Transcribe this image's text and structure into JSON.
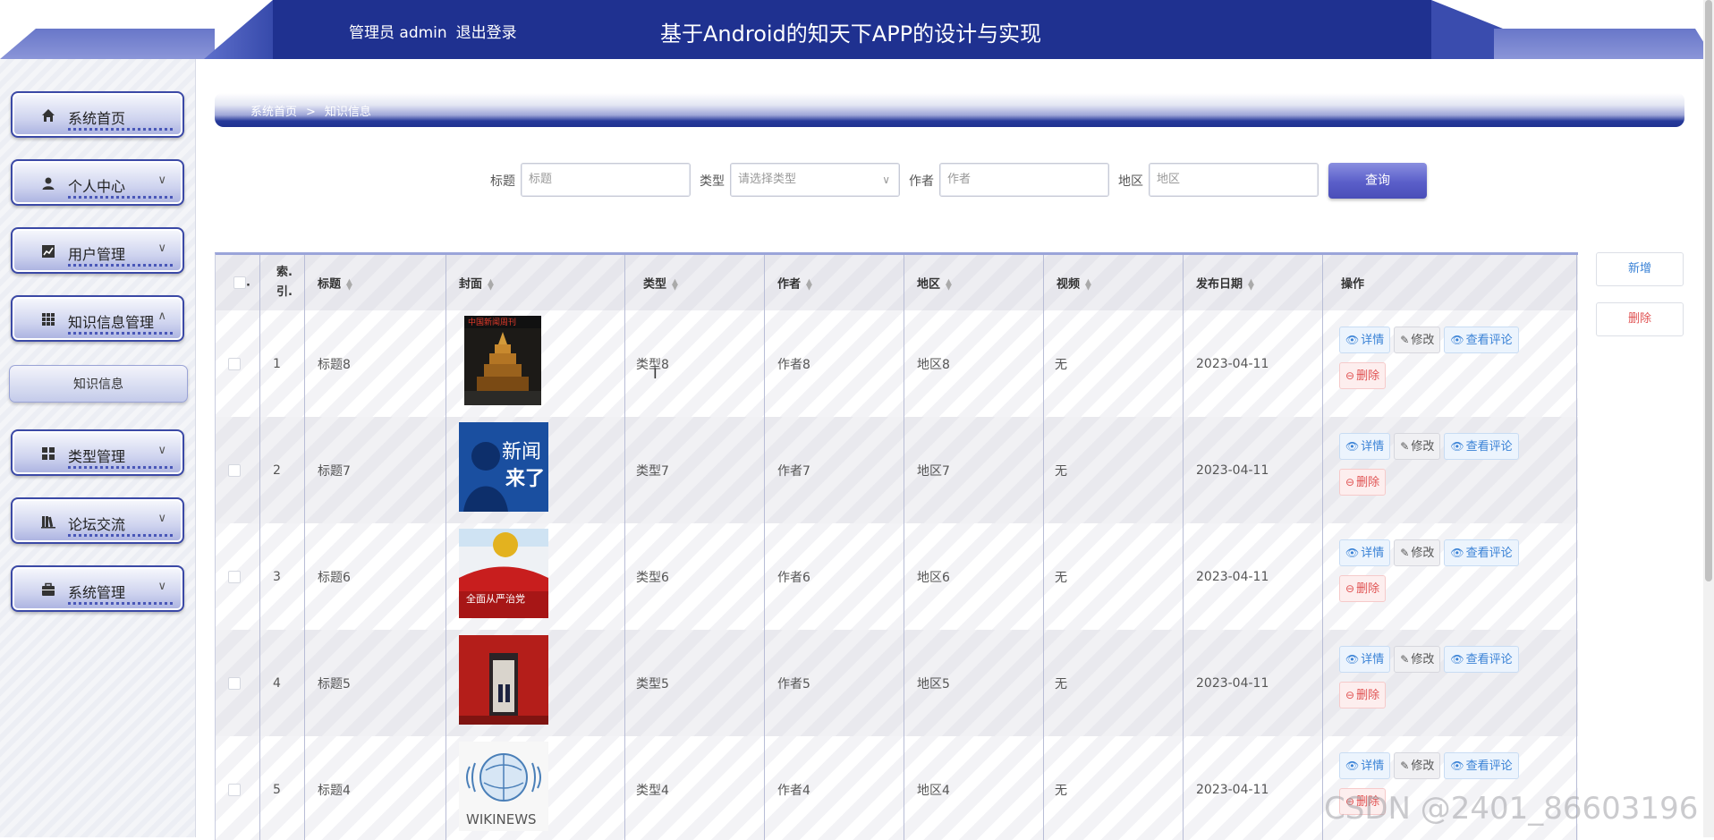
{
  "header": {
    "admin_label": "管理员 admin",
    "logout_label": "退出登录",
    "app_title": "基于Android的知天下APP的设计与实现"
  },
  "sidebar": {
    "items": [
      {
        "label": "系统首页",
        "icon": "home-icon",
        "chevron": ""
      },
      {
        "label": "个人中心",
        "icon": "user-icon",
        "chevron": "∨"
      },
      {
        "label": "用户管理",
        "icon": "chart-icon",
        "chevron": "∨"
      },
      {
        "label": "知识信息管理",
        "icon": "grid-icon",
        "chevron": "∧"
      },
      {
        "label": "类型管理",
        "icon": "apps-icon",
        "chevron": "∨"
      },
      {
        "label": "论坛交流",
        "icon": "books-icon",
        "chevron": "∨"
      },
      {
        "label": "系统管理",
        "icon": "briefcase-icon",
        "chevron": "∨"
      }
    ],
    "sub_item": "知识信息"
  },
  "breadcrumb": {
    "home": "系统首页",
    "sep": ">",
    "current": "知识信息"
  },
  "search": {
    "title_label": "标题",
    "title_placeholder": "标题",
    "type_label": "类型",
    "type_placeholder": "请选择类型",
    "author_label": "作者",
    "author_placeholder": "作者",
    "region_label": "地区",
    "region_placeholder": "地区",
    "query_label": "查询"
  },
  "actions": {
    "add_label": "新增",
    "delete_label": "删除"
  },
  "table": {
    "checkbox_dot": ".",
    "headers": {
      "index": "索.\n引.",
      "title": "标题",
      "cover": "封面",
      "type": "类型",
      "author": "作者",
      "region": "地区",
      "video": "视频",
      "date": "发布日期",
      "ops": "操作"
    },
    "op_labels": {
      "detail": "详情",
      "edit": "修改",
      "comments": "查看评论",
      "delete": "删除"
    },
    "rows": [
      {
        "index": "1",
        "title": "标题8",
        "type": "类型8",
        "author": "作者8",
        "region": "地区8",
        "video": "无",
        "date": "2023-04-11",
        "cover": "magazine"
      },
      {
        "index": "2",
        "title": "标题7",
        "type": "类型7",
        "author": "作者7",
        "region": "地区7",
        "video": "无",
        "date": "2023-04-11",
        "cover": "news"
      },
      {
        "index": "3",
        "title": "标题6",
        "type": "类型6",
        "author": "作者6",
        "region": "地区6",
        "video": "无",
        "date": "2023-04-11",
        "cover": "party"
      },
      {
        "index": "4",
        "title": "标题5",
        "type": "类型5",
        "author": "作者5",
        "region": "地区5",
        "video": "无",
        "date": "2023-04-11",
        "cover": "hall"
      },
      {
        "index": "5",
        "title": "标题4",
        "type": "类型4",
        "author": "作者4",
        "region": "地区4",
        "video": "无",
        "date": "2023-04-11",
        "cover": "wikinews"
      }
    ]
  },
  "cover_text": {
    "magazine_banner": "中国新闻周刊",
    "news_line1": "新闻",
    "news_line2": "来了",
    "party_caption": "全面从严治党",
    "wikinews": "WIKINEWS"
  },
  "watermark": "CSDN @2401_86603196",
  "colors": {
    "brand": "#1e3190",
    "accent": "#5a5ec9",
    "link": "#3a82d6",
    "danger": "#e05252"
  }
}
